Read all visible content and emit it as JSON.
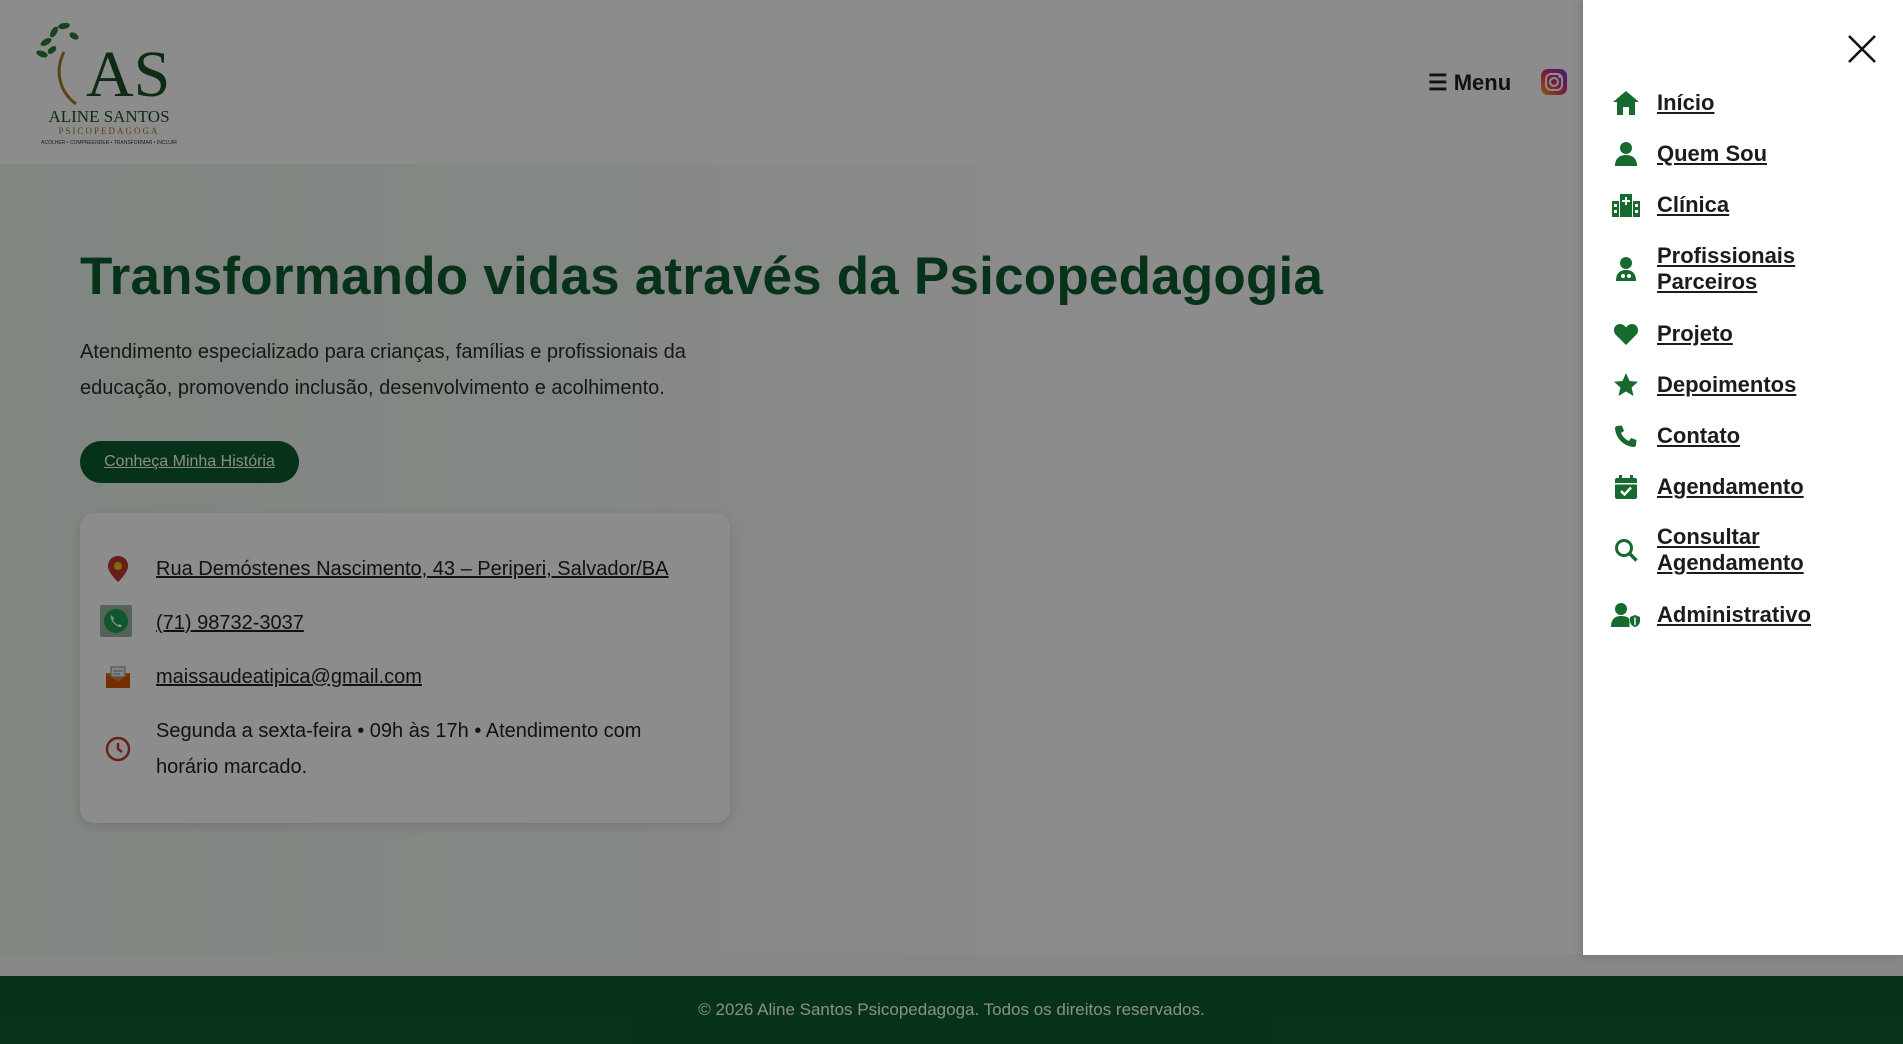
{
  "logo": {
    "monogram": "AS",
    "name": "ALINE SANTOS",
    "profession": "PSICOPEDAGOGA",
    "tagline": "ACOLHER • COMPREENDER • TRANSFORMAR • INCLUIR"
  },
  "header": {
    "menu_label": "Menu",
    "menu_icon": "hamburger-icon",
    "social_icon": "instagram-icon"
  },
  "hero": {
    "title": "Transformando vidas através da Psicopedagogia",
    "description": "Atendimento especializado para crianças, famílias e profissionais da educação, promovendo inclusão, desenvolvimento e acolhimento.",
    "cta_label": "Conheça Minha História"
  },
  "contact": {
    "address": "Rua Demóstenes Nascimento, 43 – Periperi, Salvador/BA",
    "phone": "(71) 98732-3037",
    "email": "maissaudeatipica@gmail.com",
    "hours": "Segunda a sexta-feira • 09h às 17h • Atendimento com horário marcado."
  },
  "footer": {
    "copyright": "© 2026 Aline Santos Psicopedagoga. Todos os direitos reservados."
  },
  "drawer": {
    "close_icon": "close-icon",
    "items": [
      {
        "label": "Início",
        "icon": "home-icon"
      },
      {
        "label": "Quem Sou",
        "icon": "user-icon"
      },
      {
        "label": "Clínica",
        "icon": "clinic-icon"
      },
      {
        "label": "Profissionais Parceiros",
        "icon": "doctor-icon"
      },
      {
        "label": "Projeto",
        "icon": "heart-icon"
      },
      {
        "label": "Depoimentos",
        "icon": "star-icon"
      },
      {
        "label": "Contato",
        "icon": "phone-icon"
      },
      {
        "label": "Agendamento",
        "icon": "calendar-check-icon"
      },
      {
        "label": "Consultar Agendamento",
        "icon": "search-icon"
      },
      {
        "label": "Administrativo",
        "icon": "user-shield-icon"
      }
    ]
  },
  "colors": {
    "brand_green": "#0b5c2e",
    "icon_green": "#176a2d",
    "overlay": "rgba(0,0,0,0.45)"
  }
}
